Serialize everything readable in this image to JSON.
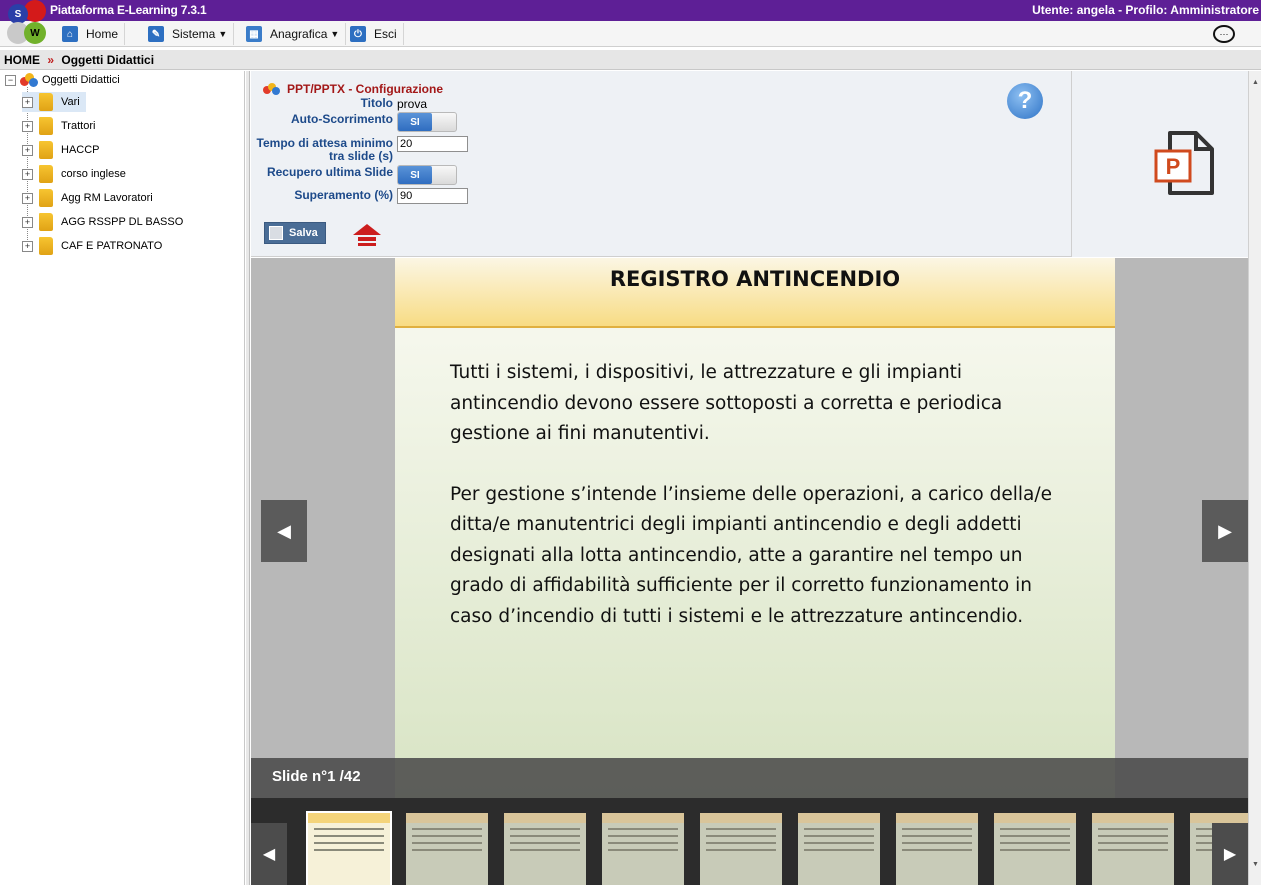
{
  "header": {
    "app_title": "Piattaforma E-Learning 7.3.1",
    "user_info": "Utente: angela - Profilo: Amministratore",
    "logo_letters": [
      "S",
      "W"
    ]
  },
  "menu": {
    "items": [
      {
        "label": "Home",
        "icon": "home-icon"
      },
      {
        "label": "Sistema",
        "icon": "wrench-icon"
      },
      {
        "label": "Anagrafica",
        "icon": "table-icon"
      },
      {
        "label": "Esci",
        "icon": "power-icon"
      }
    ],
    "chat_icon": "chat-icon"
  },
  "breadcrumb": {
    "home": "HOME",
    "separator": "»",
    "current": "Oggetti Didattici"
  },
  "tree": {
    "root_label": "Oggetti Didattici",
    "items": [
      {
        "label": "Vari",
        "selected": true
      },
      {
        "label": "Trattori",
        "selected": false
      },
      {
        "label": "HACCP",
        "selected": false
      },
      {
        "label": "corso inglese",
        "selected": false
      },
      {
        "label": "Agg RM Lavoratori",
        "selected": false
      },
      {
        "label": "AGG RSSPP DL BASSO",
        "selected": false
      },
      {
        "label": "CAF E PATRONATO",
        "selected": false
      }
    ]
  },
  "config": {
    "title": "PPT/PPTX - Configurazione",
    "fields": {
      "titolo_label": "Titolo",
      "titolo_value": "prova",
      "auto_scroll_label": "Auto-Scorrimento",
      "auto_scroll_value": "SI",
      "wait_label_1": "Tempo di attesa minimo",
      "wait_label_2": "tra slide (s)",
      "wait_value": "20",
      "recover_label": "Recupero ultima Slide",
      "recover_value": "SI",
      "pass_label": "Superamento (%)",
      "pass_value": "90"
    },
    "save_label": "Salva",
    "help_symbol": "?"
  },
  "slide": {
    "title": "REGISTRO ANTINCENDIO",
    "paragraphs": [
      "Tutti i sistemi, i dispositivi, le attrezzature e gli impianti antincendio devono essere sottoposti a corretta e periodica gestione ai fini manutentivi.",
      "Per gestione s’intende l’insieme delle operazioni, a carico della/e ditta/e manutentrici degli impianti antincendio e degli addetti designati alla lotta antincendio, atte a garantire nel tempo un grado di affidabilità sufficiente per il corretto funzionamento in caso d’incendio di tutti i sistemi e le attrezzature antincendio."
    ],
    "counter": "Slide n°1 /42"
  },
  "colors": {
    "topbar": "#5e1f96",
    "config_title": "#a31818",
    "label_blue": "#1d4a8a",
    "ppt_orange": "#d04a1e"
  }
}
